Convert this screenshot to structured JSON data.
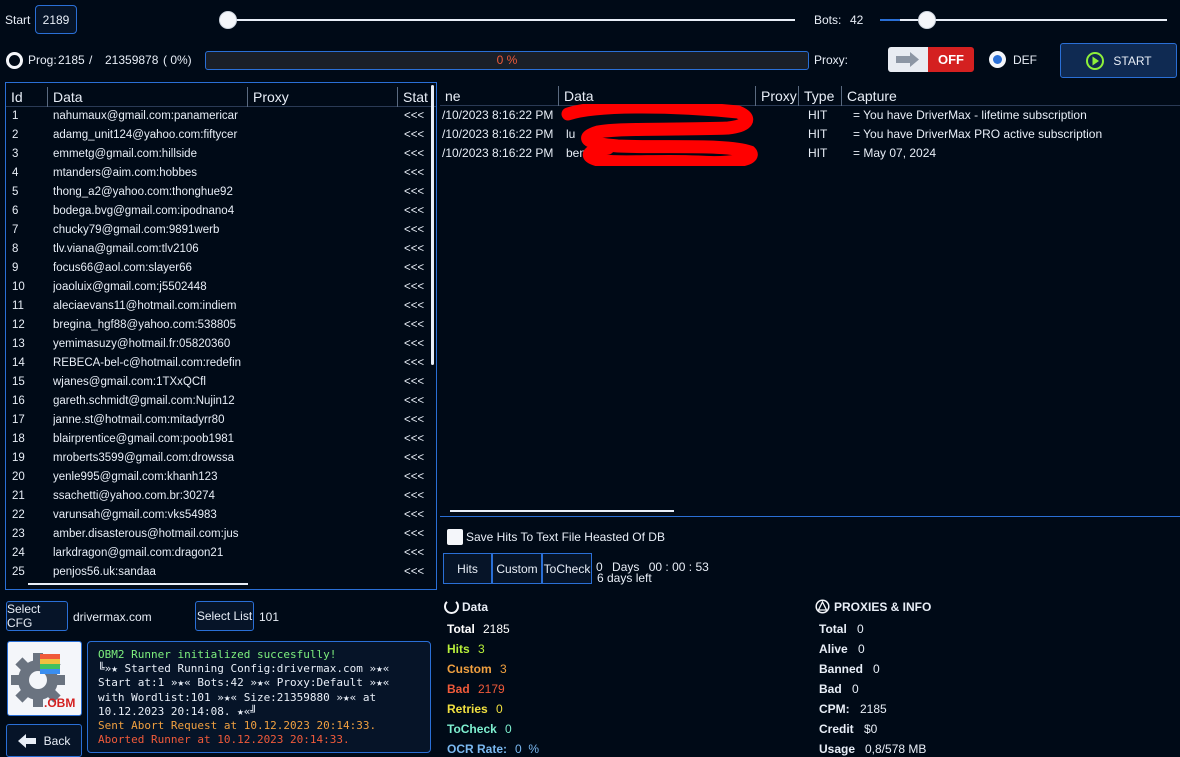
{
  "top": {
    "start_label": "Start",
    "start_value": "2189",
    "start_slider_fraction": 0.0,
    "bots_label": "Bots:",
    "bots_value": "42",
    "bots_slider_fraction": 0.1,
    "prog_label": "Prog:",
    "prog_current": "2185",
    "prog_sep": "/",
    "prog_total": "21359878",
    "prog_pct": "( 0%)",
    "progress_text": "0 %",
    "progress_fraction": 0.0,
    "proxy_label": "Proxy:",
    "proxy_toggle": "OFF",
    "def_label": "DEF",
    "start_button": "START"
  },
  "left_table": {
    "headers": [
      "Id",
      "Data",
      "Proxy",
      "Stat"
    ],
    "rows": [
      {
        "id": "1",
        "data": "nahumaux@gmail.com:panamericar",
        "stat": "<<<"
      },
      {
        "id": "2",
        "data": "adamg_unit124@yahoo.com:fiftycer",
        "stat": "<<<"
      },
      {
        "id": "3",
        "data": "emmetg@gmail.com:hillside",
        "stat": "<<<"
      },
      {
        "id": "4",
        "data": "mtanders@aim.com:hobbes",
        "stat": "<<<"
      },
      {
        "id": "5",
        "data": "thong_a2@yahoo.com:thonghue92",
        "stat": "<<<"
      },
      {
        "id": "6",
        "data": "bodega.bvg@gmail.com:ipodnano4",
        "stat": "<<<"
      },
      {
        "id": "7",
        "data": "chucky79@gmail.com:9891werb",
        "stat": "<<<"
      },
      {
        "id": "8",
        "data": "tlv.viana@gmail.com:tlv2106",
        "stat": "<<<"
      },
      {
        "id": "9",
        "data": "focus66@aol.com:slayer66",
        "stat": "<<<"
      },
      {
        "id": "10",
        "data": "joaoluix@gmail.com:j5502448",
        "stat": "<<<"
      },
      {
        "id": "11",
        "data": "aleciaevans11@hotmail.com:indiem",
        "stat": "<<<"
      },
      {
        "id": "12",
        "data": "bregina_hgf88@yahoo.com:538805",
        "stat": "<<<"
      },
      {
        "id": "13",
        "data": "yemimasuzy@hotmail.fr:05820360",
        "stat": "<<<"
      },
      {
        "id": "14",
        "data": "REBECA-bel-c@hotmail.com:redefin",
        "stat": "<<<"
      },
      {
        "id": "15",
        "data": "wjanes@gmail.com:1TXxQCfl",
        "stat": "<<<"
      },
      {
        "id": "16",
        "data": "gareth.schmidt@gmail.com:Nujin12",
        "stat": "<<<"
      },
      {
        "id": "17",
        "data": "janne.st@hotmail.com:mitadyrr80",
        "stat": "<<<"
      },
      {
        "id": "18",
        "data": "blairprentice@gmail.com:poob1981",
        "stat": "<<<"
      },
      {
        "id": "19",
        "data": "mroberts3599@gmail.com:drowssa",
        "stat": "<<<"
      },
      {
        "id": "20",
        "data": "yenle995@gmail.com:khanh123",
        "stat": "<<<"
      },
      {
        "id": "21",
        "data": "ssachetti@yahoo.com.br:30274",
        "stat": "<<<"
      },
      {
        "id": "22",
        "data": "varunsah@gmail.com:vks54983",
        "stat": "<<<"
      },
      {
        "id": "23",
        "data": "amber.disasterous@hotmail.com:jus",
        "stat": "<<<"
      },
      {
        "id": "24",
        "data": "larkdragon@gmail.com:dragon21",
        "stat": "<<<"
      },
      {
        "id": "25",
        "data": "penjos56.uk:sandaa",
        "stat": "<<<"
      }
    ]
  },
  "right_table": {
    "headers": [
      "ne",
      "Data",
      "Proxy",
      "Type",
      "Capture"
    ],
    "rows": [
      {
        "time": "/10/2023 8:16:22 PM",
        "data": "",
        "type": "HIT",
        "capture": "= You have DriverMax - lifetime subscription"
      },
      {
        "time": "/10/2023 8:16:22 PM",
        "data": "lu",
        "type": "HIT",
        "capture": "= You have DriverMax PRO active subscription"
      },
      {
        "time": "/10/2023 8:16:22 PM",
        "data": "ben",
        "type": "HIT",
        "capture": "= May 07, 2024"
      }
    ],
    "redaction_color": "#ff0000"
  },
  "save_hits_label": "Save Hits To Text File Heasted Of DB",
  "tabs": [
    "Hits",
    "Custom",
    "ToCheck"
  ],
  "timer": {
    "days_value": "0",
    "days_label": "Days",
    "hh": "00",
    "mm": "00",
    "ss": "53",
    "days_left": "6 days left"
  },
  "bottom_left": {
    "select_cfg": "Select CFG",
    "cfg_name": "drivermax.com",
    "select_list": "Select List",
    "list_name": "101",
    "back": "Back",
    "logo_text": ".OBM"
  },
  "log": {
    "lines": [
      {
        "text": "OBM2 Runner initialized succesfully!",
        "color": "#7ef07e"
      },
      {
        "text": "╚»★ Started Running Config:drivermax.com »★«",
        "color": "#e8eef7"
      },
      {
        "text": "Start at:1 »★« Bots:42 »★« Proxy:Default »★«",
        "color": "#e8eef7"
      },
      {
        "text": "with Wordlist:101 »★« Size:21359880 »★« at",
        "color": "#e8eef7"
      },
      {
        "text": "10.12.2023 20:14:08. ★«╝",
        "color": "#e8eef7"
      },
      {
        "text": "Sent Abort Request at 10.12.2023 20:14:33.",
        "color": "#f0a040"
      },
      {
        "text": "Aborted Runner at 10.12.2023 20:14:33.",
        "color": "#f05a3a"
      }
    ]
  },
  "data_stats": {
    "title": "Data",
    "items": [
      {
        "label": "Total",
        "value": "2185",
        "color": "#ffffff"
      },
      {
        "label": "Hits",
        "value": "3",
        "color": "#b8f03a"
      },
      {
        "label": "Custom",
        "value": "3",
        "color": "#f0a040"
      },
      {
        "label": "Bad",
        "value": "2179",
        "color": "#f05a3a"
      },
      {
        "label": "Retries",
        "value": "0",
        "color": "#f0e040"
      },
      {
        "label": "ToCheck",
        "value": "0",
        "color": "#7ef0d0"
      },
      {
        "label": "OCR Rate:",
        "value": "0  %",
        "color": "#7ab8f0"
      }
    ]
  },
  "proxy_info": {
    "title": "PROXIES & INFO",
    "items": [
      {
        "label": "Total",
        "value": "0"
      },
      {
        "label": "Alive",
        "value": "0"
      },
      {
        "label": "Banned",
        "value": "0"
      },
      {
        "label": "Bad",
        "value": "0"
      },
      {
        "label": "CPM:",
        "value": "2185"
      },
      {
        "label": "Credit",
        "value": "$0"
      },
      {
        "label": "Usage",
        "value": "0,8/578 MB"
      }
    ]
  }
}
